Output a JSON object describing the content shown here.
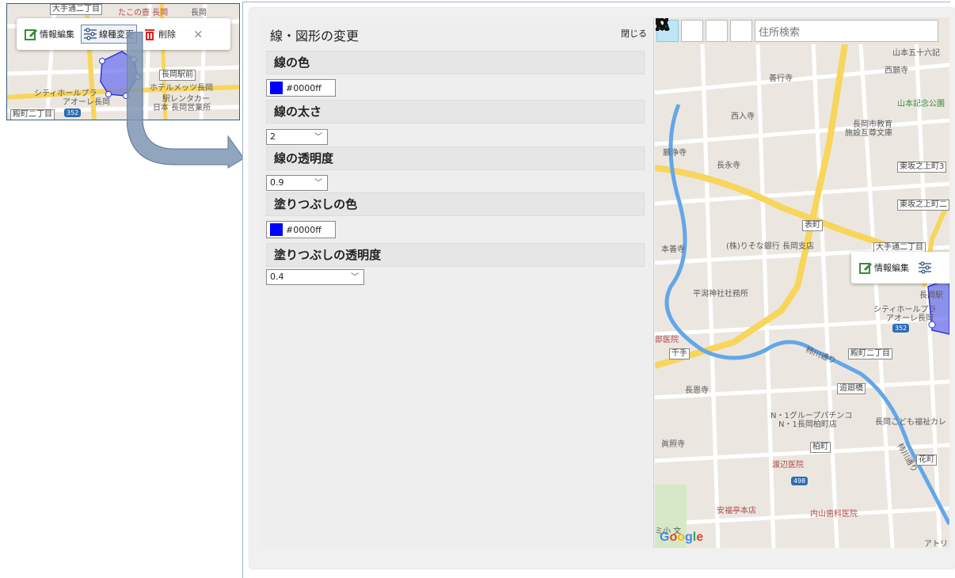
{
  "inset": {
    "popup": {
      "edit_label": "情報編集",
      "style_label": "線種変更",
      "delete_label": "削除"
    },
    "labels": {
      "street1": "大手通二丁目",
      "place1": "たこの壺 長岡",
      "place2": "長岡",
      "station": "長岡駅前",
      "hotel": "ホテルメッツ長岡",
      "city_hall1": "シティホールプラ",
      "city_hall2": "アオーレ長岡",
      "rental1": "駅レンタカー",
      "rental2": "日本 長岡営業所",
      "route": "352",
      "street2": "殿町二丁目"
    }
  },
  "panel": {
    "title": "線・図形の変更",
    "close_label": "閉じる",
    "line_color_label": "線の色",
    "line_color_value": "#0000ff",
    "line_width_label": "線の太さ",
    "line_width_value": "2",
    "line_opacity_label": "線の透明度",
    "line_opacity_value": "0.9",
    "fill_color_label": "塗りつぶしの色",
    "fill_color_value": "#0000ff",
    "fill_opacity_label": "塗りつぶしの透明度",
    "fill_opacity_value": "0.4"
  },
  "map": {
    "toolbar": {
      "icons": [
        "pointer-icon",
        "marker-icon",
        "polyline-icon",
        "rectangle-icon",
        "search-icon"
      ],
      "search_placeholder": "住所検索"
    },
    "popup": {
      "edit_label": "情報編集"
    },
    "labels": {
      "top_partial": "山本五十六記",
      "saigan": "西願寺",
      "zengyo": "善行寺",
      "yamamoto": "山本記念公園",
      "sainyu": "西入寺",
      "edu1": "長岡市教育",
      "edu2": "施設互尊文庫",
      "ganjo": "願浄寺",
      "choei": "長永寺",
      "higashi1": "東坂之上町3",
      "higashi2": "東坂之上町二",
      "omote": "表町",
      "honzen": "本善寺",
      "bank": "(株)りそな銀行 長岡支店",
      "otedori": "大手通二丁目",
      "hirashio": "平潟神社社務所",
      "city_hall1": "シティホールプラ",
      "city_hall2": "アオーレ長岡",
      "nagaoka_partial": "長岡駅",
      "route": "352",
      "hospital_partial": "部医院",
      "senju": "千手",
      "kakigawa": "柿川通り",
      "tonomachi": "殿町二丁目",
      "oiwake": "追廻橋",
      "chogen": "長恩寺",
      "n1a": "N・1グループパチンコ",
      "n1b": "N・1長岡柏町店",
      "kodomo": "長岡こども福祉カレ",
      "shinsho": "眞照寺",
      "kashiwa": "柏町",
      "watanabe": "渡辺医院",
      "hanabi": "花町",
      "kakigawa2": "柿川通り",
      "route2": "498",
      "anpuku": "安福亭本店",
      "uchiyama": "内山歯科医院",
      "school_partial": "ミ小 文",
      "atori": "アトリ",
      "google": "Google"
    }
  },
  "colors": {
    "accent_blue": "#0000ff",
    "connector": "#7f95b3",
    "road_yellow": "#f8d55b",
    "water": "#64a7e8"
  }
}
